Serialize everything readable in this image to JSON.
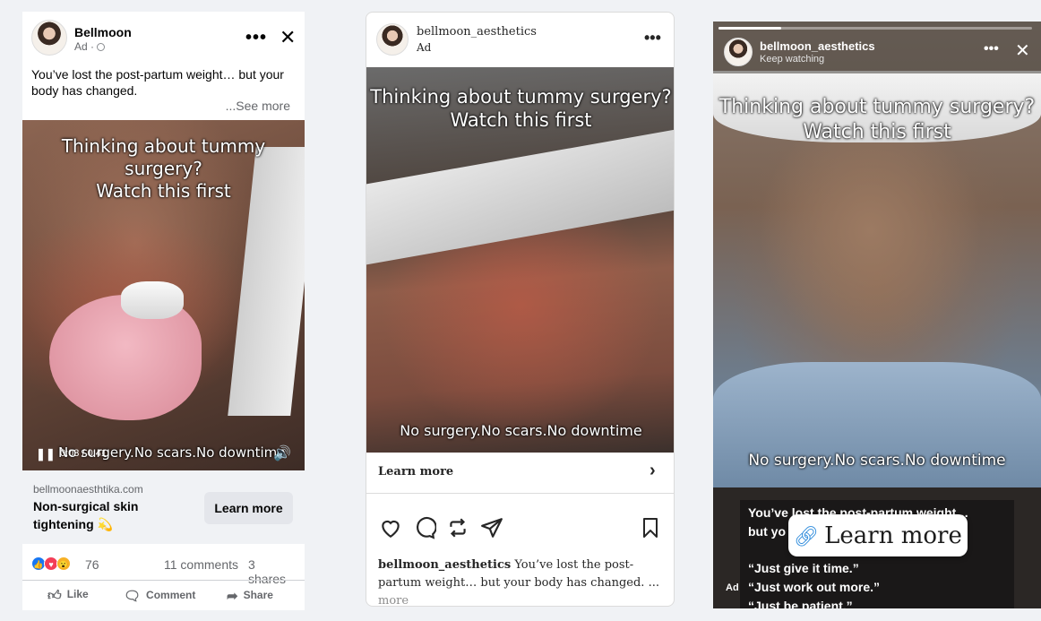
{
  "facebook": {
    "page_name": "Bellmoon",
    "sub": "Ad ·",
    "menu": "•••",
    "close": "✕",
    "text": "You’ve lost the post-partum weight… but your body has changed.",
    "see_more": "...See more",
    "caption_top": "Thinking about tummy surgery?\nWatch this first",
    "caption_bottom": "No surgery.No scars.No downtime",
    "play_icon": "pause-icon",
    "time": "0:03 / 0:41",
    "domain": "bellmoonaesthtika.com",
    "headline": "Non-surgical skin tightening 💫",
    "cta": "Learn more",
    "reaction_count": "76",
    "comments": "11 comments",
    "shares": "3 shares",
    "actions": {
      "like": "Like",
      "comment": "Comment",
      "share": "Share"
    },
    "colors": {
      "like_blue": "#1877f2",
      "love_red": "#f33e58",
      "wow_yellow": "#f7b125"
    }
  },
  "instagram": {
    "username": "bellmoon_aesthetics",
    "sub": "Ad",
    "menu": "•••",
    "caption_top": "Thinking about tummy surgery?\nWatch this first",
    "caption_bottom": "No surgery.No scars.No downtime",
    "cta": "Learn more",
    "chevron": "›",
    "caption_user": "bellmoon_aesthetics",
    "caption_text": " You’ve lost the post-partum weight… but your body has changed. ... ",
    "caption_more": "more"
  },
  "story": {
    "username": "bellmoon_aesthetics",
    "sub": "Keep watching",
    "menu": "•••",
    "close": "✕",
    "progress": 0.2,
    "caption_top": "Thinking about tummy surgery?\nWatch this first",
    "caption_bottom": "No surgery.No scars.No downtime",
    "lines": [
      "You’ve lost the post-partum weight…",
      "but yo",
      "“Just give it time.”",
      "“Just work out more.”",
      "“Just be patient.”"
    ],
    "ad": "Ad",
    "cta": "Learn more"
  }
}
